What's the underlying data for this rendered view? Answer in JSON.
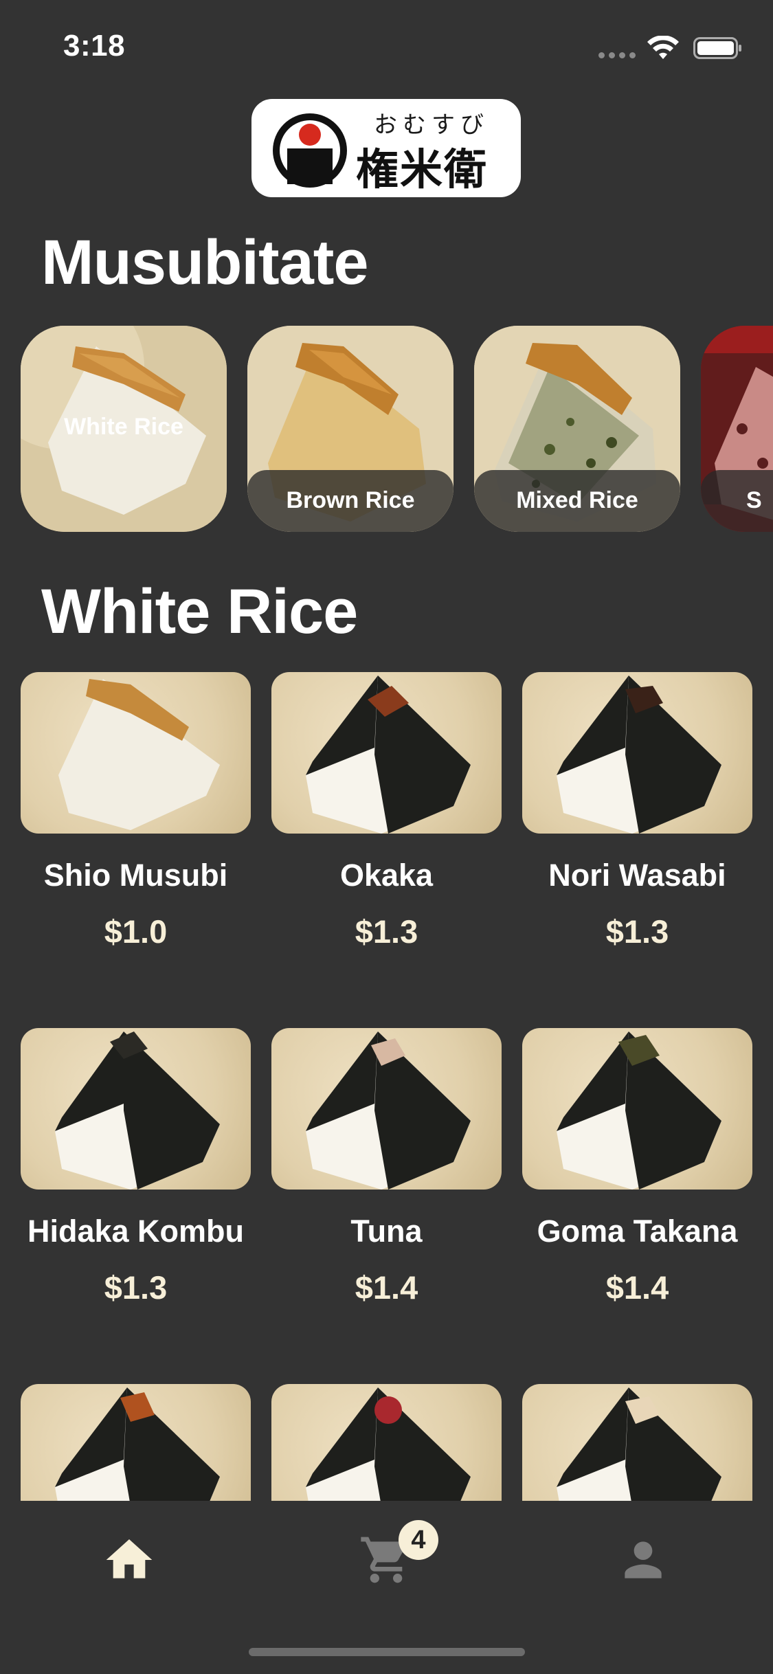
{
  "status_bar": {
    "time": "3:18"
  },
  "logo": {
    "kana": "おむすび",
    "kanji": "権米衛"
  },
  "sections": {
    "featured_title": "Musubitate",
    "grid_title": "White Rice"
  },
  "categories": [
    {
      "label": "White Rice",
      "icon": "white-rice-onigiri"
    },
    {
      "label": "Brown Rice",
      "icon": "brown-rice-onigiri"
    },
    {
      "label": "Mixed Rice",
      "icon": "mixed-rice-onigiri"
    },
    {
      "label": "S",
      "icon": "red-rice-onigiri"
    }
  ],
  "products": [
    {
      "name": "Shio Musubi",
      "price": "$1.0",
      "style": "plain-sesame"
    },
    {
      "name": "Okaka",
      "price": "$1.3",
      "style": "nori-okaka"
    },
    {
      "name": "Nori Wasabi",
      "price": "$1.3",
      "style": "nori-wasabi"
    },
    {
      "name": "Hidaka Kombu",
      "price": "$1.3",
      "style": "nori-kombu"
    },
    {
      "name": "Tuna",
      "price": "$1.4",
      "style": "nori-tuna"
    },
    {
      "name": "Goma Takana",
      "price": "$1.4",
      "style": "nori-takana"
    },
    {
      "name": "",
      "price": "",
      "style": "nori-red-topping"
    },
    {
      "name": "",
      "price": "",
      "style": "nori-ume"
    },
    {
      "name": "",
      "price": "",
      "style": "nori-light-topping"
    }
  ],
  "tab_bar": {
    "cart_count": "4",
    "tabs": [
      {
        "icon": "home-icon",
        "active": true
      },
      {
        "icon": "cart-icon",
        "active": false
      },
      {
        "icon": "profile-icon",
        "active": false
      }
    ]
  },
  "colors": {
    "background": "#333333",
    "accent": "#f7efd8",
    "inactive_icon": "#7a7a7a",
    "logo_red": "#d62a1e"
  }
}
